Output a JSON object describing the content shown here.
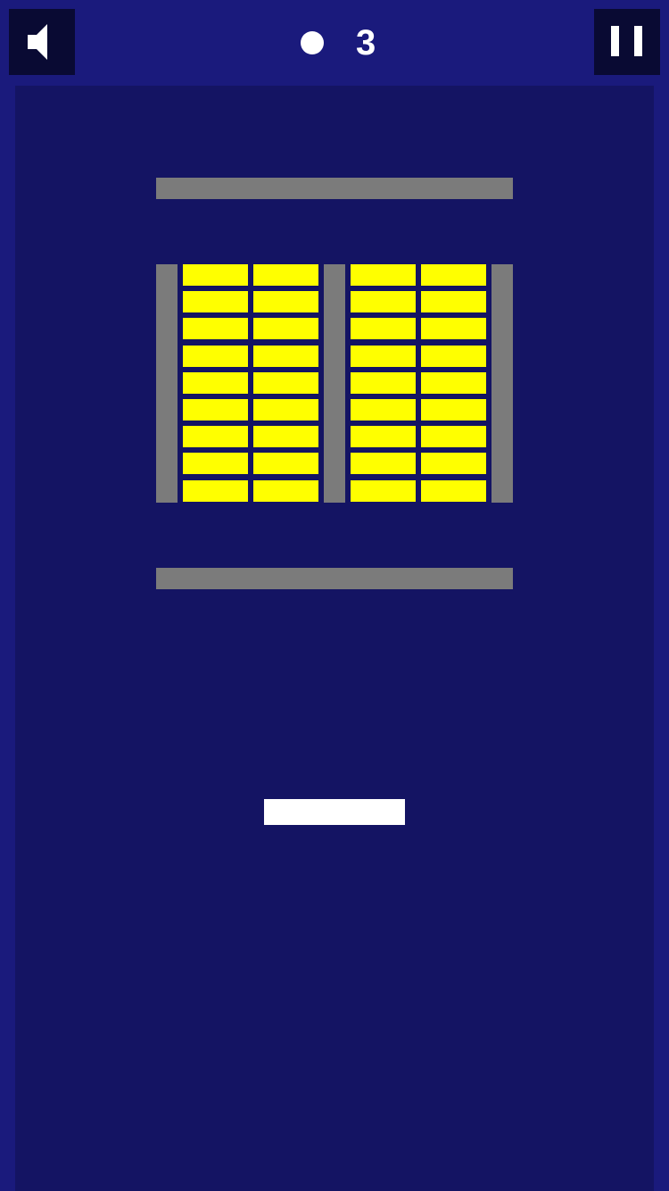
{
  "hud": {
    "lives": "3",
    "sound_icon": "speaker-icon",
    "pause_icon": "pause-icon",
    "ball_icon": "ball-icon"
  },
  "colors": {
    "background": "#1a1a7c",
    "field": "#141463",
    "button": "#090a33",
    "wall": "#7b7b7b",
    "brick": "#ffff00",
    "paddle": "#ffffff"
  },
  "bricks": {
    "columns": 4,
    "rows": 9
  }
}
